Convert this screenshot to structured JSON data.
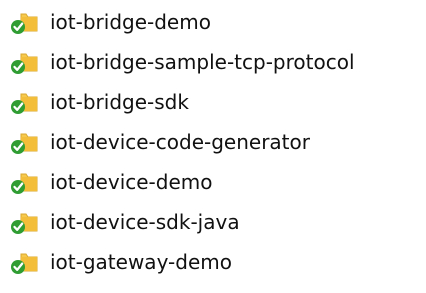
{
  "folders": [
    {
      "name": "iot-bridge-demo",
      "icon": "folder-check-icon"
    },
    {
      "name": "iot-bridge-sample-tcp-protocol",
      "icon": "folder-check-icon"
    },
    {
      "name": "iot-bridge-sdk",
      "icon": "folder-check-icon"
    },
    {
      "name": "iot-device-code-generator",
      "icon": "folder-check-icon"
    },
    {
      "name": "iot-device-demo",
      "icon": "folder-check-icon"
    },
    {
      "name": "iot-device-sdk-java",
      "icon": "folder-check-icon"
    },
    {
      "name": "iot-gateway-demo",
      "icon": "folder-check-icon"
    }
  ],
  "colors": {
    "folder_yellow": "#f6c84b",
    "folder_shadow": "#d9a932",
    "check_green": "#2f9d32",
    "text": "#111111"
  }
}
